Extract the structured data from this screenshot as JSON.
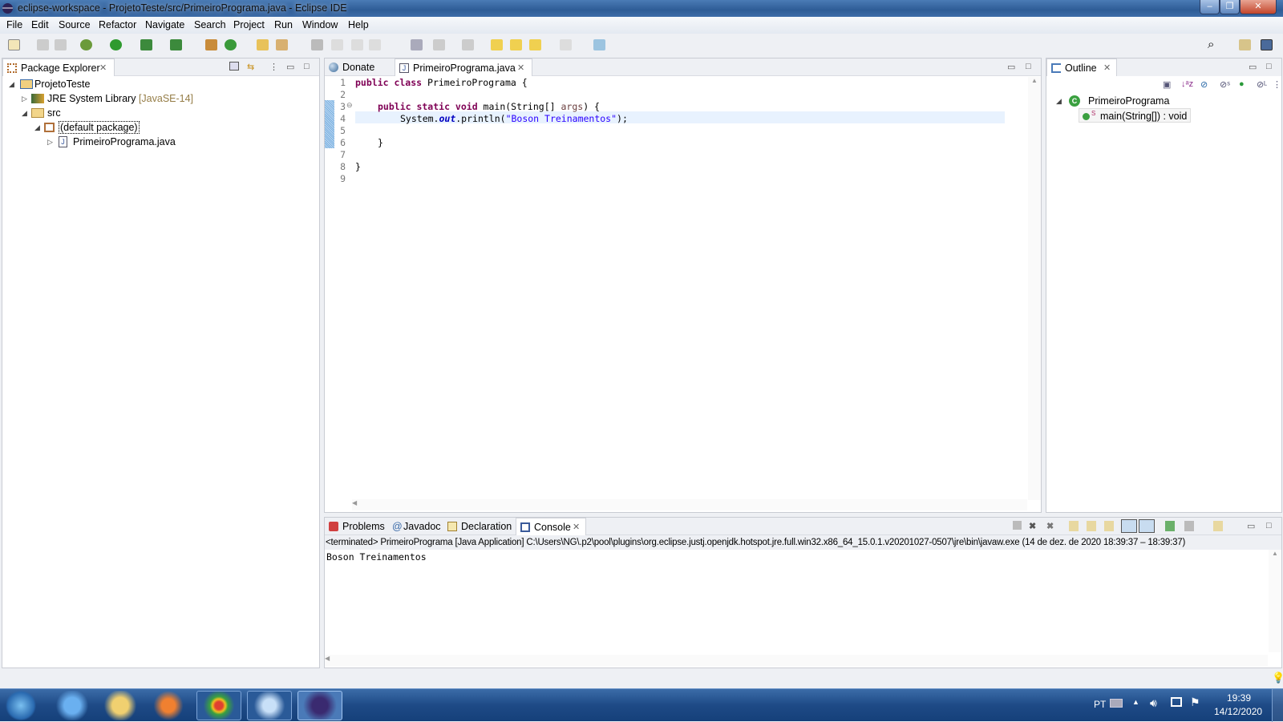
{
  "window": {
    "title": "eclipse-workspace - ProjetoTeste/src/PrimeiroPrograma.java - Eclipse IDE"
  },
  "menu": [
    "File",
    "Edit",
    "Source",
    "Refactor",
    "Navigate",
    "Search",
    "Project",
    "Run",
    "Window",
    "Help"
  ],
  "package_explorer": {
    "title": "Package Explorer",
    "tree": [
      {
        "label": "ProjetoTeste",
        "extra": ""
      },
      {
        "label": "JRE System Library",
        "extra": "[JavaSE-14]"
      },
      {
        "label": "src",
        "extra": ""
      },
      {
        "label": "(default package)",
        "extra": ""
      },
      {
        "label": "PrimeiroPrograma.java",
        "extra": ""
      }
    ]
  },
  "editor": {
    "tabs": [
      "Donate",
      "PrimeiroPrograma.java"
    ],
    "line_numbers": [
      "1",
      "2",
      "3",
      "4",
      "5",
      "6",
      "7",
      "8",
      "9"
    ],
    "code": {
      "l1_kw": "public class",
      "l1_rest": " PrimeiroPrograma {",
      "l3_kw": "public static void",
      "l3_mid": " main(String[] ",
      "l3_arg": "args",
      "l3_end": ") {",
      "l4_a": "System.",
      "l4_field": "out",
      "l4_b": ".println(",
      "l4_str": "\"Boson Treinamentos\"",
      "l4_end": ");",
      "l6": "}",
      "l8": "}"
    }
  },
  "outline": {
    "title": "Outline",
    "class_name": "PrimeiroPrograma",
    "method": "main(String[]) : void"
  },
  "console": {
    "tabs": [
      "Problems",
      "Javadoc",
      "Declaration",
      "Console"
    ],
    "status": "<terminated> PrimeiroPrograma [Java Application] C:\\Users\\NG\\.p2\\pool\\plugins\\org.eclipse.justj.openjdk.hotspot.jre.full.win32.x86_64_15.0.1.v20201027-0507\\jre\\bin\\javaw.exe  (14 de dez. de 2020 18:39:37 – 18:39:37)",
    "output": "Boson Treinamentos"
  },
  "taskbar": {
    "lang": "PT",
    "time": "19:39",
    "date": "14/12/2020"
  }
}
